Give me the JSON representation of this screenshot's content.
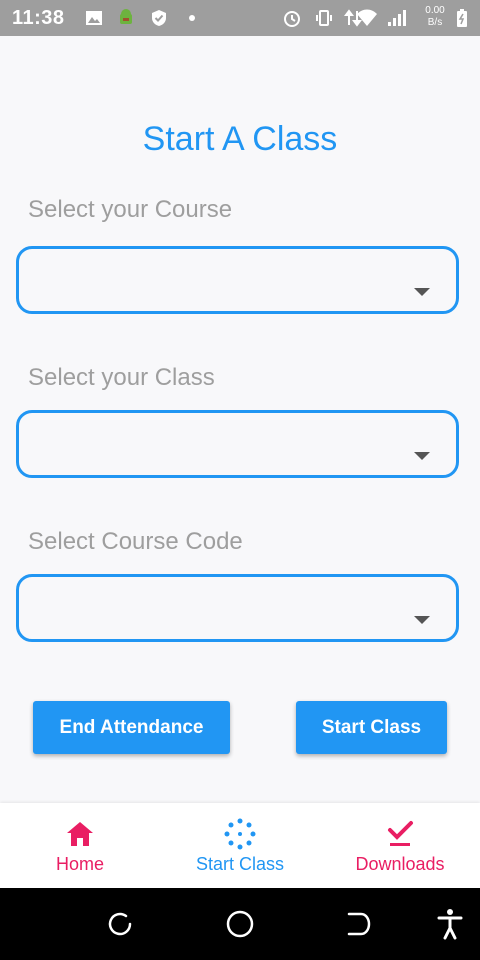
{
  "status_bar": {
    "time": "11:38",
    "net_speed_value": "0.00",
    "net_speed_unit": "B/s",
    "icons": [
      "image-icon",
      "android-icon",
      "shield-icon",
      "dot-icon",
      "alarm-icon",
      "vibrate-icon",
      "data-arrows-icon",
      "wifi-icon",
      "signal-icon",
      "battery-icon"
    ]
  },
  "page": {
    "title": "Start A Class"
  },
  "form": {
    "course_label": "Select your Course",
    "class_label": "Select your Class",
    "course_code_label": "Select Course Code"
  },
  "buttons": {
    "end_attendance": "End Attendance",
    "start_class": "Start Class"
  },
  "bottom_nav": {
    "items": [
      {
        "label": "Home",
        "icon": "home-icon",
        "color": "#e91e63"
      },
      {
        "label": "Start Class",
        "icon": "spinner-icon",
        "color": "#2196f3",
        "active": true
      },
      {
        "label": "Downloads",
        "icon": "check-icon",
        "color": "#e91e63"
      }
    ]
  },
  "colors": {
    "accent": "#2196f3",
    "nav_pink": "#e91e63",
    "label_gray": "#9e9e9e"
  }
}
